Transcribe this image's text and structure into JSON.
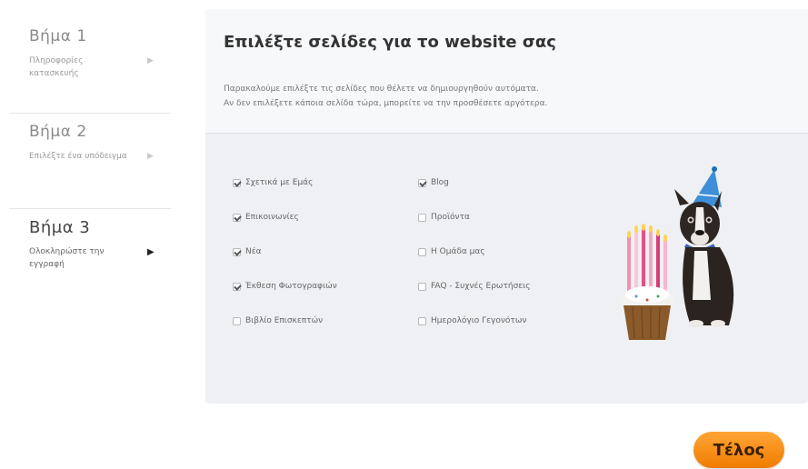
{
  "steps": [
    {
      "title": "Βήμα 1",
      "subtitle": "Πληροφορίες κατασκευής",
      "active": false
    },
    {
      "title": "Βήμα 2",
      "subtitle": "Επιλέξτε ένα υπόδειγμα",
      "active": false
    },
    {
      "title": "Βήμα 3",
      "subtitle": "Ολοκληρώστε την εγγραφή",
      "active": true
    }
  ],
  "panel": {
    "title": "Επιλέξτε σελίδες για το website σας",
    "desc_line1": "Παρακαλούμε επιλέξτε τις σελίδες που θέλετε να δημιουργηθούν αυτόματα.",
    "desc_line2": "Αν δεν επιλέξετε κάποια σελίδα τώρα, μπορείτε να την προσθέσετε αργότερα."
  },
  "options_left": [
    {
      "label": "Σχετικά με Εμάς",
      "checked": true
    },
    {
      "label": "Επικοινωνίες",
      "checked": true
    },
    {
      "label": "Νέα",
      "checked": true
    },
    {
      "label": "Έκθεση Φωτογραφιών",
      "checked": true
    },
    {
      "label": "Βιβλίο Επισκεπτών",
      "checked": false
    }
  ],
  "options_right": [
    {
      "label": "Blog",
      "checked": true
    },
    {
      "label": "Προϊόντα",
      "checked": false
    },
    {
      "label": "Η Ομάδα μας",
      "checked": false
    },
    {
      "label": "FAQ - Συχνές Ερωτήσεις",
      "checked": false
    },
    {
      "label": "Ημερολόγιο Γεγονότων",
      "checked": false
    }
  ],
  "finish_label": "Τέλος",
  "colors": {
    "accent": "#f28c16",
    "panel_bg": "#eef0f3"
  },
  "illustration": "dog-with-party-hat-and-cupcake"
}
